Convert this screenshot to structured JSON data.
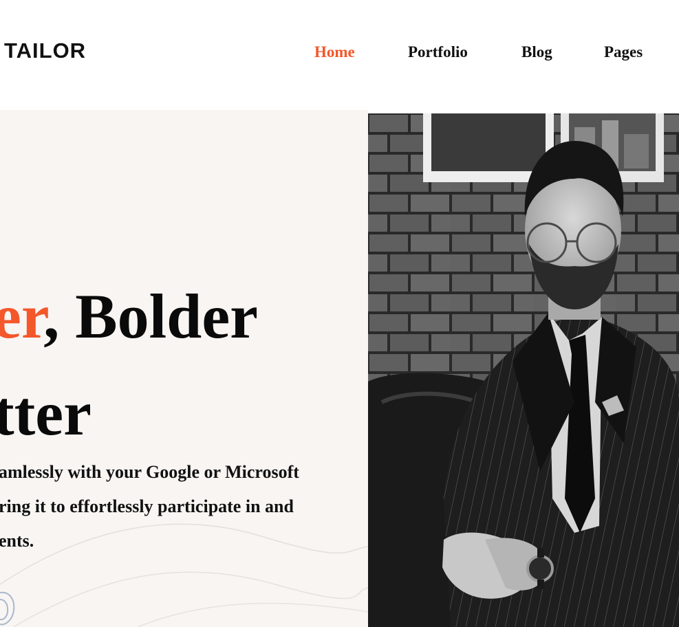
{
  "brand": {
    "logo_text": "TAILOR"
  },
  "nav": {
    "items": [
      {
        "label": "Home",
        "active": true
      },
      {
        "label": "Portfolio",
        "active": false
      },
      {
        "label": "Blog",
        "active": false
      },
      {
        "label": "Pages",
        "active": false
      }
    ]
  },
  "hero": {
    "headline_line1_accent": "er",
    "headline_line1_rest": ", Bolder",
    "headline_line2": "tter",
    "paragraph_lines": [
      "amlessly with your Google or Microsoft",
      "ring it to effortlessly participate in and",
      "ents."
    ]
  },
  "colors": {
    "accent": "#f4572a",
    "hero_background": "#f8f5f3",
    "text": "#111111"
  }
}
